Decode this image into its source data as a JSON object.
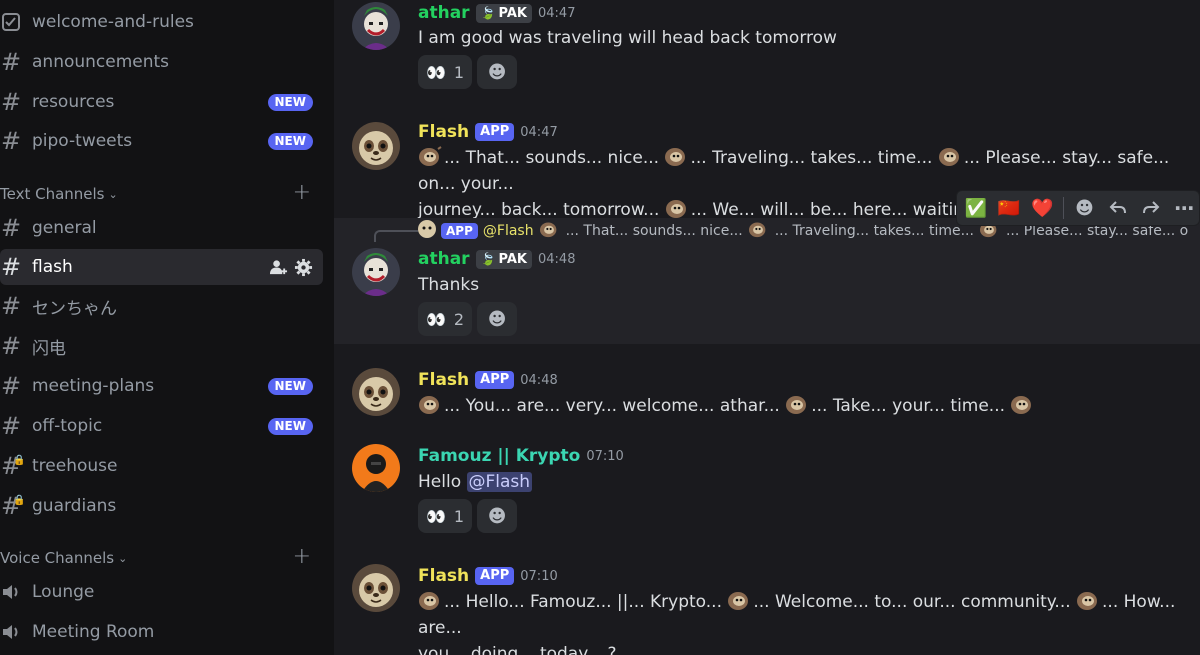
{
  "sidebar": {
    "channels_top": [
      {
        "name": "welcome-and-rules",
        "icon": "rules-icon"
      },
      {
        "name": "announcements",
        "icon": "hash-icon"
      },
      {
        "name": "resources",
        "icon": "hash-icon",
        "badge": "NEW"
      },
      {
        "name": "pipo-tweets",
        "icon": "hash-icon",
        "badge": "NEW"
      }
    ],
    "text_category": "Text Channels",
    "text_channels": [
      {
        "name": "general",
        "icon": "hash-icon"
      },
      {
        "name": "flash",
        "icon": "hash-icon",
        "active": true
      },
      {
        "name": "センちゃん",
        "icon": "hash-icon"
      },
      {
        "name": "闪电",
        "icon": "hash-icon"
      },
      {
        "name": "meeting-plans",
        "icon": "hash-icon",
        "badge": "NEW"
      },
      {
        "name": "off-topic",
        "icon": "hash-icon",
        "badge": "NEW"
      },
      {
        "name": "treehouse",
        "icon": "locked-hash-icon"
      },
      {
        "name": "guardians",
        "icon": "locked-hash-icon"
      }
    ],
    "voice_category": "Voice Channels",
    "voice_channels": [
      {
        "name": "Lounge",
        "icon": "speaker-icon"
      },
      {
        "name": "Meeting Room",
        "icon": "speaker-icon"
      }
    ]
  },
  "messages": {
    "m1": {
      "author": "athar",
      "tag": "PAK",
      "time": "04:47",
      "text": "I am good was traveling will head back tomorrow",
      "reaction_emoji": "👀",
      "reaction_count": "1"
    },
    "m2": {
      "author": "Flash",
      "app": "APP",
      "time": "04:47",
      "s1": "... That... sounds... nice...",
      "s2": "... Traveling... takes... time...",
      "s3": "... Please... stay... safe... on... your...",
      "s4": "journey... back... tomorrow...",
      "s5": "... We... will... be... here... waiting... patiently..."
    },
    "m3": {
      "author": "athar",
      "tag": "PAK",
      "time": "04:48",
      "text": "Thanks",
      "reaction_emoji": "👀",
      "reaction_count": "2",
      "reply_app": "APP",
      "reply_name": "@Flash",
      "reply_s1": "... That... sounds... nice...",
      "reply_s2": "... Traveling... takes... time...",
      "reply_s3": "... Please... stay... safe... on... y..."
    },
    "m4": {
      "author": "Flash",
      "app": "APP",
      "time": "04:48",
      "s1": "... You... are... very... welcome... athar...",
      "s2": "... Take... your... time..."
    },
    "m5": {
      "author": "Famouz || Krypto",
      "time": "07:10",
      "text": "Hello",
      "mention": "@Flash",
      "reaction_emoji": "👀",
      "reaction_count": "1"
    },
    "m6": {
      "author": "Flash",
      "app": "APP",
      "time": "07:10",
      "s1": "... Hello... Famouz... ||... Krypto...",
      "s2": "... Welcome... to... our... community...",
      "s3": "... How... are...",
      "s4": "you... doing... today... ?"
    }
  },
  "toolbar": {
    "react1": "✅",
    "react2": "🇨🇳",
    "react3": "❤️",
    "icons": [
      "add-reaction-icon",
      "reply-icon",
      "forward-icon",
      "more-icon"
    ]
  },
  "colors": {
    "athar": "#23d160",
    "flash": "#f0e35a",
    "famouz": "#3bd6b2",
    "accent": "#5865f2"
  }
}
